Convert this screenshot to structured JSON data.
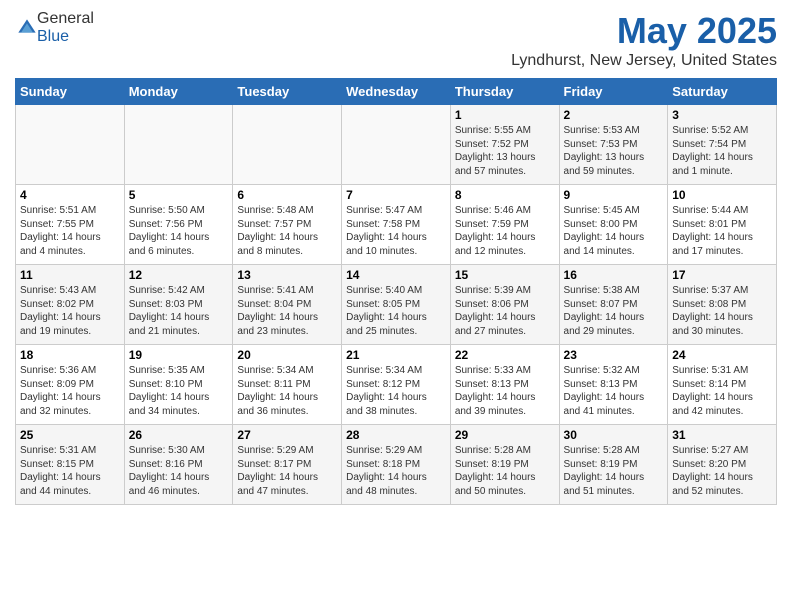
{
  "header": {
    "logo_general": "General",
    "logo_blue": "Blue",
    "title": "May 2025",
    "location": "Lyndhurst, New Jersey, United States"
  },
  "calendar": {
    "days_of_week": [
      "Sunday",
      "Monday",
      "Tuesday",
      "Wednesday",
      "Thursday",
      "Friday",
      "Saturday"
    ],
    "weeks": [
      [
        {
          "day": "",
          "info": ""
        },
        {
          "day": "",
          "info": ""
        },
        {
          "day": "",
          "info": ""
        },
        {
          "day": "",
          "info": ""
        },
        {
          "day": "1",
          "info": "Sunrise: 5:55 AM\nSunset: 7:52 PM\nDaylight: 13 hours\nand 57 minutes."
        },
        {
          "day": "2",
          "info": "Sunrise: 5:53 AM\nSunset: 7:53 PM\nDaylight: 13 hours\nand 59 minutes."
        },
        {
          "day": "3",
          "info": "Sunrise: 5:52 AM\nSunset: 7:54 PM\nDaylight: 14 hours\nand 1 minute."
        }
      ],
      [
        {
          "day": "4",
          "info": "Sunrise: 5:51 AM\nSunset: 7:55 PM\nDaylight: 14 hours\nand 4 minutes."
        },
        {
          "day": "5",
          "info": "Sunrise: 5:50 AM\nSunset: 7:56 PM\nDaylight: 14 hours\nand 6 minutes."
        },
        {
          "day": "6",
          "info": "Sunrise: 5:48 AM\nSunset: 7:57 PM\nDaylight: 14 hours\nand 8 minutes."
        },
        {
          "day": "7",
          "info": "Sunrise: 5:47 AM\nSunset: 7:58 PM\nDaylight: 14 hours\nand 10 minutes."
        },
        {
          "day": "8",
          "info": "Sunrise: 5:46 AM\nSunset: 7:59 PM\nDaylight: 14 hours\nand 12 minutes."
        },
        {
          "day": "9",
          "info": "Sunrise: 5:45 AM\nSunset: 8:00 PM\nDaylight: 14 hours\nand 14 minutes."
        },
        {
          "day": "10",
          "info": "Sunrise: 5:44 AM\nSunset: 8:01 PM\nDaylight: 14 hours\nand 17 minutes."
        }
      ],
      [
        {
          "day": "11",
          "info": "Sunrise: 5:43 AM\nSunset: 8:02 PM\nDaylight: 14 hours\nand 19 minutes."
        },
        {
          "day": "12",
          "info": "Sunrise: 5:42 AM\nSunset: 8:03 PM\nDaylight: 14 hours\nand 21 minutes."
        },
        {
          "day": "13",
          "info": "Sunrise: 5:41 AM\nSunset: 8:04 PM\nDaylight: 14 hours\nand 23 minutes."
        },
        {
          "day": "14",
          "info": "Sunrise: 5:40 AM\nSunset: 8:05 PM\nDaylight: 14 hours\nand 25 minutes."
        },
        {
          "day": "15",
          "info": "Sunrise: 5:39 AM\nSunset: 8:06 PM\nDaylight: 14 hours\nand 27 minutes."
        },
        {
          "day": "16",
          "info": "Sunrise: 5:38 AM\nSunset: 8:07 PM\nDaylight: 14 hours\nand 29 minutes."
        },
        {
          "day": "17",
          "info": "Sunrise: 5:37 AM\nSunset: 8:08 PM\nDaylight: 14 hours\nand 30 minutes."
        }
      ],
      [
        {
          "day": "18",
          "info": "Sunrise: 5:36 AM\nSunset: 8:09 PM\nDaylight: 14 hours\nand 32 minutes."
        },
        {
          "day": "19",
          "info": "Sunrise: 5:35 AM\nSunset: 8:10 PM\nDaylight: 14 hours\nand 34 minutes."
        },
        {
          "day": "20",
          "info": "Sunrise: 5:34 AM\nSunset: 8:11 PM\nDaylight: 14 hours\nand 36 minutes."
        },
        {
          "day": "21",
          "info": "Sunrise: 5:34 AM\nSunset: 8:12 PM\nDaylight: 14 hours\nand 38 minutes."
        },
        {
          "day": "22",
          "info": "Sunrise: 5:33 AM\nSunset: 8:13 PM\nDaylight: 14 hours\nand 39 minutes."
        },
        {
          "day": "23",
          "info": "Sunrise: 5:32 AM\nSunset: 8:13 PM\nDaylight: 14 hours\nand 41 minutes."
        },
        {
          "day": "24",
          "info": "Sunrise: 5:31 AM\nSunset: 8:14 PM\nDaylight: 14 hours\nand 42 minutes."
        }
      ],
      [
        {
          "day": "25",
          "info": "Sunrise: 5:31 AM\nSunset: 8:15 PM\nDaylight: 14 hours\nand 44 minutes."
        },
        {
          "day": "26",
          "info": "Sunrise: 5:30 AM\nSunset: 8:16 PM\nDaylight: 14 hours\nand 46 minutes."
        },
        {
          "day": "27",
          "info": "Sunrise: 5:29 AM\nSunset: 8:17 PM\nDaylight: 14 hours\nand 47 minutes."
        },
        {
          "day": "28",
          "info": "Sunrise: 5:29 AM\nSunset: 8:18 PM\nDaylight: 14 hours\nand 48 minutes."
        },
        {
          "day": "29",
          "info": "Sunrise: 5:28 AM\nSunset: 8:19 PM\nDaylight: 14 hours\nand 50 minutes."
        },
        {
          "day": "30",
          "info": "Sunrise: 5:28 AM\nSunset: 8:19 PM\nDaylight: 14 hours\nand 51 minutes."
        },
        {
          "day": "31",
          "info": "Sunrise: 5:27 AM\nSunset: 8:20 PM\nDaylight: 14 hours\nand 52 minutes."
        }
      ]
    ]
  }
}
